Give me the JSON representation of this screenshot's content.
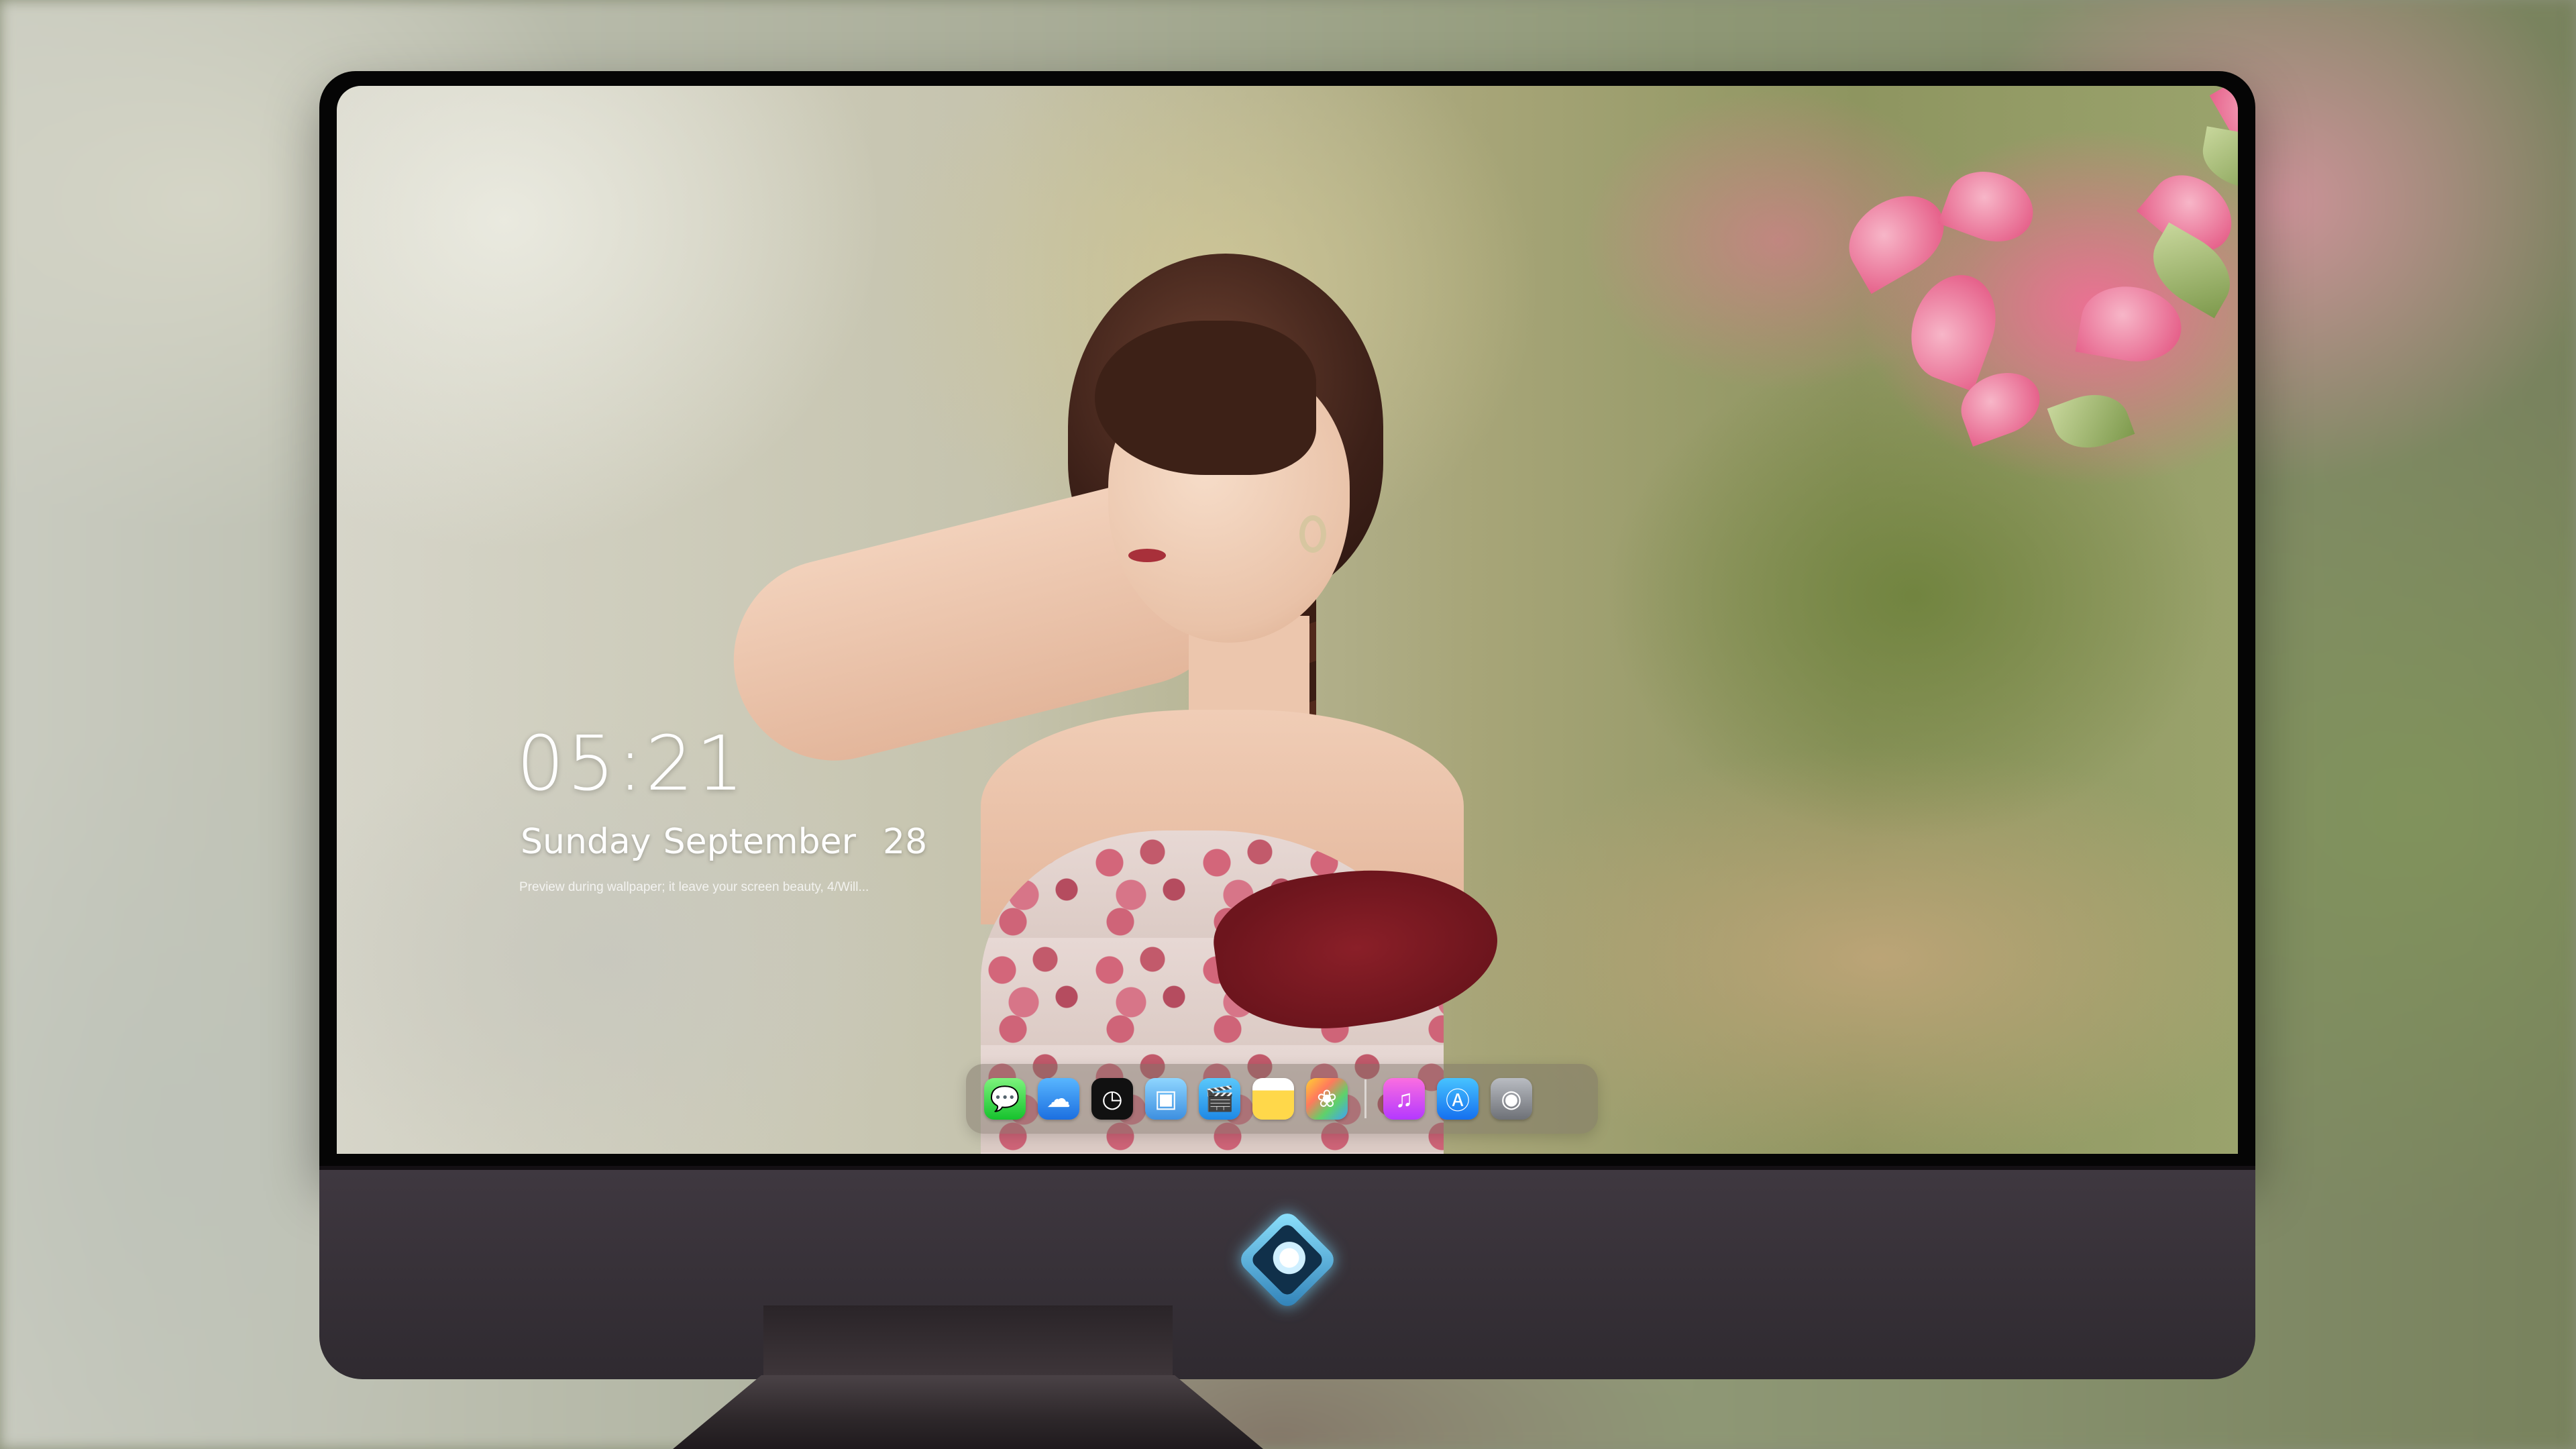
{
  "lock_screen": {
    "time": "05:21",
    "weekday": "Sunday",
    "month": "September",
    "day": "28",
    "hint": "Preview during wallpaper; it leave your screen beauty, 4/Will..."
  },
  "dock": {
    "apps": [
      {
        "name": "Messages",
        "icon": "messages-icon",
        "glyph": "💬"
      },
      {
        "name": "Weather",
        "icon": "weather-icon",
        "glyph": "☁"
      },
      {
        "name": "Clock",
        "icon": "clock-icon",
        "glyph": "◷"
      },
      {
        "name": "Preview",
        "icon": "preview-icon",
        "glyph": "▣"
      },
      {
        "name": "Clips",
        "icon": "clips-icon",
        "glyph": "🎬"
      },
      {
        "name": "Notes",
        "icon": "notes-icon",
        "glyph": ""
      },
      {
        "name": "Photos",
        "icon": "photos-icon",
        "glyph": "❀"
      },
      {
        "name": "Music",
        "icon": "music-icon",
        "glyph": "♫"
      },
      {
        "name": "App Store",
        "icon": "app-store-icon",
        "glyph": "Ⓐ"
      },
      {
        "name": "Camera",
        "icon": "camera-icon",
        "glyph": "◉"
      }
    ]
  },
  "colors": {
    "bezel": "#050505",
    "chin": "#3a3439",
    "dock_bg": "rgba(120,110,100,0.45)",
    "clock_text": "#ffffff"
  }
}
